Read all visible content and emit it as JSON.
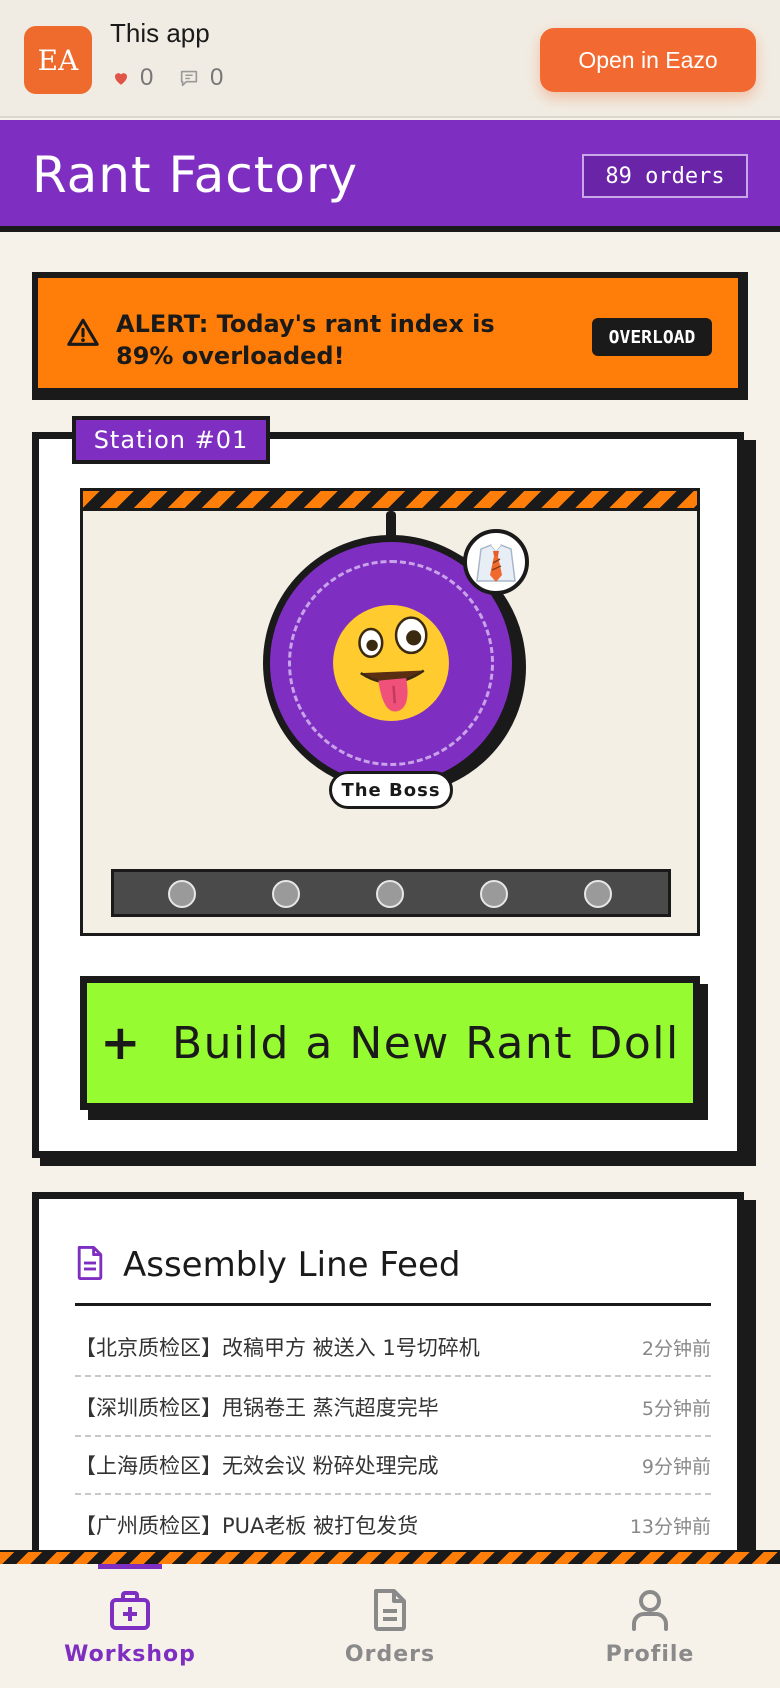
{
  "topbar": {
    "logo_text": "EA",
    "app_name": "This app",
    "likes": "0",
    "comments": "0",
    "open_button": "Open in Eazo"
  },
  "header": {
    "title": "Rant Factory",
    "orders_badge": "89 orders"
  },
  "alert": {
    "text": "ALERT: Today's rant index is 89% overloaded!",
    "badge": "OVERLOAD",
    "color": "#ff7d09"
  },
  "station": {
    "tag": "Station #01",
    "doll_label": "The Boss",
    "doll_emoji": "🤪",
    "accessory_emoji": "👔",
    "build_button": "Build a New Rant Doll"
  },
  "feed": {
    "title": "Assembly Line Feed",
    "items": [
      {
        "message": "【北京质检区】改稿甲方  被送入 1号切碎机",
        "time": "2分钟前"
      },
      {
        "message": "【深圳质检区】甩锅卷王  蒸汽超度完毕",
        "time": "5分钟前"
      },
      {
        "message": "【上海质检区】无效会议  粉碎处理完成",
        "time": "9分钟前"
      },
      {
        "message": "【广州质检区】PUA老板  被打包发货",
        "time": "13分钟前"
      }
    ]
  },
  "nav": {
    "items": [
      {
        "label": "Workshop",
        "icon": "toolbox-icon",
        "active": true
      },
      {
        "label": "Orders",
        "icon": "document-icon",
        "active": false
      },
      {
        "label": "Profile",
        "icon": "user-icon",
        "active": false
      }
    ],
    "active_color": "#7e2fc1",
    "inactive_color": "#8a8a8a"
  },
  "colors": {
    "brand_purple": "#7e2fc1",
    "accent_orange": "#ff7d09",
    "build_green": "#97fb31"
  }
}
